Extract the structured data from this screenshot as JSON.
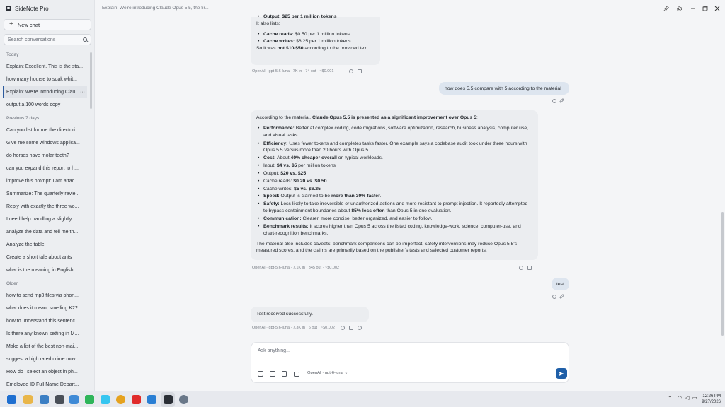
{
  "app": {
    "title": "SideNote Pro",
    "new_chat_label": "New chat",
    "search_placeholder": "Search conversations"
  },
  "sections": {
    "today": "Today",
    "previous7": "Previous 7 days",
    "older": "Older"
  },
  "conversations": {
    "today": [
      "Explain: Excellent. This is the sta...",
      "how many hourse to soak whit...",
      "Explain: We're introducing Clau...",
      "output a 100 words copy"
    ],
    "previous7": [
      "Can you list for me the directori...",
      "Give me some windows applica...",
      "do horses have molar teeth?",
      "can you expand this report to h...",
      "improve this prompt: I am attac...",
      "Summarize: The quarterly revie...",
      "Reply with exactly the three wo...",
      "I need help handling a slightly...",
      "analyze the data and tell me th...",
      "Analyze the table",
      "Create a short tale about ants",
      "what is the meaning in English..."
    ],
    "older": [
      "how to send mp3 files via phon...",
      "what does it mean, smelling K2?",
      "how to understand this sentenc...",
      "Is there any known setting in M...",
      "Make a list of the best non-mai...",
      "suggest a high rated crime mov...",
      "How do i select an object in ph...",
      "Emolovee ID Full Name Depart..."
    ],
    "active_more": "···"
  },
  "header": {
    "title": "Explain: We're introducing Claude Opus 5.5, the fir..."
  },
  "messages": {
    "m1": {
      "partial_top": "Output: $25 per 1 million tokens",
      "also_lists": "It also lists:",
      "cache_reads_label": "Cache reads:",
      "cache_reads_value": "$0.50 per 1 million tokens",
      "cache_writes_label": "Cache writes:",
      "cache_writes_value": "$6.25 per 1 million tokens",
      "so_prefix": "So it was ",
      "so_bold": "not $10/$50",
      "so_suffix": " according to the provided text.",
      "meta": "OpenAI · gpt-5.6-luna · 7K in · 74 out · ~$0.001"
    },
    "u1": {
      "text": "how does 5.5 compare with 5 according to the material"
    },
    "m2": {
      "intro_prefix": "According to the material, ",
      "intro_bold": "Claude Opus 5.5 is presented as a significant improvement over Opus 5",
      "intro_suffix": ":",
      "perf_label": "Performance:",
      "perf_text": " Better at complex coding, code migrations, software optimization, research, business analysis, computer use, and visual tasks.",
      "eff_label": "Efficiency:",
      "eff_text": " Uses fewer tokens and completes tasks faster. One example says a codebase audit took under three hours with Opus 5.5 versus more than 20 hours with Opus 5.",
      "cost_label": "Cost:",
      "cost_mid": " About ",
      "cost_bold": "40% cheaper overall",
      "cost_suffix": " on typical workloads.",
      "input_prefix": "Input: ",
      "input_bold": "$4 vs. $5",
      "input_suffix": " per million tokens",
      "output_prefix": "Output: ",
      "output_bold": "$20 vs. $25",
      "creads_prefix": "Cache reads: ",
      "creads_bold": "$0.20 vs. $0.50",
      "cwrites_prefix": "Cache writes: ",
      "cwrites_bold": "$5 vs. $6.25",
      "speed_label": "Speed:",
      "speed_mid": " Output is claimed to be ",
      "speed_bold": "more than 30% faster",
      "speed_suffix": ".",
      "safety_label": "Safety:",
      "safety_text": " Less likely to take irreversible or unauthorized actions and more resistant to prompt injection. It reportedly attempted to bypass containment boundaries about ",
      "safety_bold": "85% less often",
      "safety_suffix": " than Opus 5 in one evaluation.",
      "comm_label": "Communication:",
      "comm_text": " Clearer, more concise, better organized, and easier to follow.",
      "bench_label": "Benchmark results:",
      "bench_text": " It scores higher than Opus 5 across the listed coding, knowledge-work, science, computer-use, and chart-recognition benchmarks.",
      "caveat": "The material also includes caveats: benchmark comparisons can be imperfect, safety interventions may reduce Opus 5.5's measured scores, and the claims are primarily based on the publisher's tests and selected customer reports.",
      "meta": "OpenAI · gpt-5.6-luna · 7.1K in · 345 out · ~$0.002"
    },
    "u2": {
      "text": "test"
    },
    "m3": {
      "text": "Test received successfully.",
      "meta": "OpenAI · gpt-5.6-luna · 7.3K in · 6 out · ~$0.002"
    }
  },
  "composer": {
    "placeholder": "Ask anything...",
    "model": "OpenAI · gpt-6-luna"
  },
  "taskbar": {
    "time": "12:26 PM",
    "date": "9/27/2026"
  },
  "colors": {
    "accent": "#1f5fa8",
    "user_bubble": "#dde5ef",
    "assistant_bubble": "#ebedf0",
    "sidebar": "#eceef1"
  }
}
